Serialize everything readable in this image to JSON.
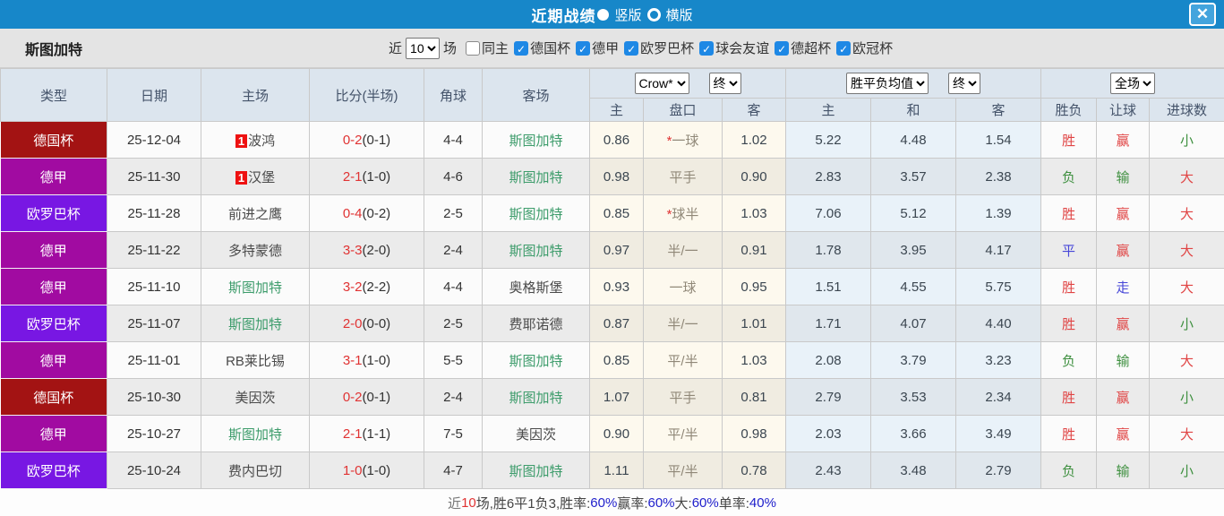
{
  "topbar": {
    "title": "近期战绩",
    "radio_vertical": "竖版",
    "radio_horizontal": "横版",
    "close": "✕"
  },
  "filter": {
    "team": "斯图加特",
    "recent_label": "近",
    "recent_value": "10",
    "matches_label": "场",
    "check_glyph": "✓",
    "checkboxes": [
      {
        "label": "同主",
        "checked": false
      },
      {
        "label": "德国杯",
        "checked": true
      },
      {
        "label": "德甲",
        "checked": true
      },
      {
        "label": "欧罗巴杯",
        "checked": true
      },
      {
        "label": "球会友谊",
        "checked": true
      },
      {
        "label": "德超杯",
        "checked": true
      },
      {
        "label": "欧冠杯",
        "checked": true
      }
    ]
  },
  "header": {
    "cols": [
      "类型",
      "日期",
      "主场",
      "比分(半场)",
      "角球",
      "客场"
    ],
    "selects": {
      "odds_source": "Crow*",
      "odds_time": "终",
      "avg_label": "胜平负均值",
      "avg_time": "终",
      "scope": "全场"
    },
    "sub": [
      "主",
      "盘口",
      "客",
      "主",
      "和",
      "客",
      "胜负",
      "让球",
      "进球数"
    ]
  },
  "colors": {
    "accent_blue": "#1787c9",
    "badge_cup": "#a31313",
    "badge_league": "#a10ba1",
    "badge_europa": "#7817e3",
    "win_red": "#e04444",
    "loss_green": "#3f9040",
    "draw_blue": "#4646d8",
    "stuttgart_green": "#3d9c6b"
  },
  "table": {
    "rows": [
      {
        "type": "德国杯",
        "type_key": "cup",
        "date": "25-12-04",
        "home": "波鸿",
        "home_badge": "1",
        "home_self": false,
        "score": "0-2",
        "half": "(0-1)",
        "corner": "4-4",
        "away": "斯图加特",
        "away_self": true,
        "o_home": "0.86",
        "hcap_star": true,
        "hcap": "一球",
        "o_away": "1.02",
        "a_home": "5.22",
        "a_draw": "4.48",
        "a_away": "1.54",
        "res": "胜",
        "res_c": "r",
        "hres": "赢",
        "hres_c": "r",
        "gres": "小",
        "gres_c": "g"
      },
      {
        "type": "德甲",
        "type_key": "league",
        "date": "25-11-30",
        "home": "汉堡",
        "home_badge": "1",
        "home_self": false,
        "score": "2-1",
        "half": "(1-0)",
        "corner": "4-6",
        "away": "斯图加特",
        "away_self": true,
        "o_home": "0.98",
        "hcap_star": false,
        "hcap": "平手",
        "o_away": "0.90",
        "a_home": "2.83",
        "a_draw": "3.57",
        "a_away": "2.38",
        "res": "负",
        "res_c": "g",
        "hres": "输",
        "hres_c": "g",
        "gres": "大",
        "gres_c": "r"
      },
      {
        "type": "欧罗巴杯",
        "type_key": "europa",
        "date": "25-11-28",
        "home": "前进之鹰",
        "home_badge": "",
        "home_self": false,
        "score": "0-4",
        "half": "(0-2)",
        "corner": "2-5",
        "away": "斯图加特",
        "away_self": true,
        "o_home": "0.85",
        "hcap_star": true,
        "hcap": "球半",
        "o_away": "1.03",
        "a_home": "7.06",
        "a_draw": "5.12",
        "a_away": "1.39",
        "res": "胜",
        "res_c": "r",
        "hres": "赢",
        "hres_c": "r",
        "gres": "大",
        "gres_c": "r"
      },
      {
        "type": "德甲",
        "type_key": "league",
        "date": "25-11-22",
        "home": "多特蒙德",
        "home_badge": "",
        "home_self": false,
        "score": "3-3",
        "half": "(2-0)",
        "corner": "2-4",
        "away": "斯图加特",
        "away_self": true,
        "o_home": "0.97",
        "hcap_star": false,
        "hcap": "半/一",
        "o_away": "0.91",
        "a_home": "1.78",
        "a_draw": "3.95",
        "a_away": "4.17",
        "res": "平",
        "res_c": "b",
        "hres": "赢",
        "hres_c": "r",
        "gres": "大",
        "gres_c": "r"
      },
      {
        "type": "德甲",
        "type_key": "league",
        "date": "25-11-10",
        "home": "斯图加特",
        "home_badge": "",
        "home_self": true,
        "score": "3-2",
        "half": "(2-2)",
        "corner": "4-4",
        "away": "奥格斯堡",
        "away_self": false,
        "o_home": "0.93",
        "hcap_star": false,
        "hcap": "一球",
        "o_away": "0.95",
        "a_home": "1.51",
        "a_draw": "4.55",
        "a_away": "5.75",
        "res": "胜",
        "res_c": "r",
        "hres": "走",
        "hres_c": "b",
        "gres": "大",
        "gres_c": "r"
      },
      {
        "type": "欧罗巴杯",
        "type_key": "europa",
        "date": "25-11-07",
        "home": "斯图加特",
        "home_badge": "",
        "home_self": true,
        "score": "2-0",
        "half": "(0-0)",
        "corner": "2-5",
        "away": "费耶诺德",
        "away_self": false,
        "o_home": "0.87",
        "hcap_star": false,
        "hcap": "半/一",
        "o_away": "1.01",
        "a_home": "1.71",
        "a_draw": "4.07",
        "a_away": "4.40",
        "res": "胜",
        "res_c": "r",
        "hres": "赢",
        "hres_c": "r",
        "gres": "小",
        "gres_c": "g"
      },
      {
        "type": "德甲",
        "type_key": "league",
        "date": "25-11-01",
        "home": "RB莱比锡",
        "home_badge": "",
        "home_self": false,
        "score": "3-1",
        "half": "(1-0)",
        "corner": "5-5",
        "away": "斯图加特",
        "away_self": true,
        "o_home": "0.85",
        "hcap_star": false,
        "hcap": "平/半",
        "o_away": "1.03",
        "a_home": "2.08",
        "a_draw": "3.79",
        "a_away": "3.23",
        "res": "负",
        "res_c": "g",
        "hres": "输",
        "hres_c": "g",
        "gres": "大",
        "gres_c": "r"
      },
      {
        "type": "德国杯",
        "type_key": "cup",
        "date": "25-10-30",
        "home": "美因茨",
        "home_badge": "",
        "home_self": false,
        "score": "0-2",
        "half": "(0-1)",
        "corner": "2-4",
        "away": "斯图加特",
        "away_self": true,
        "o_home": "1.07",
        "hcap_star": false,
        "hcap": "平手",
        "o_away": "0.81",
        "a_home": "2.79",
        "a_draw": "3.53",
        "a_away": "2.34",
        "res": "胜",
        "res_c": "r",
        "hres": "赢",
        "hres_c": "r",
        "gres": "小",
        "gres_c": "g"
      },
      {
        "type": "德甲",
        "type_key": "league",
        "date": "25-10-27",
        "home": "斯图加特",
        "home_badge": "",
        "home_self": true,
        "score": "2-1",
        "half": "(1-1)",
        "corner": "7-5",
        "away": "美因茨",
        "away_self": false,
        "o_home": "0.90",
        "hcap_star": false,
        "hcap": "平/半",
        "o_away": "0.98",
        "a_home": "2.03",
        "a_draw": "3.66",
        "a_away": "3.49",
        "res": "胜",
        "res_c": "r",
        "hres": "赢",
        "hres_c": "r",
        "gres": "大",
        "gres_c": "r"
      },
      {
        "type": "欧罗巴杯",
        "type_key": "europa",
        "date": "25-10-24",
        "home": "费内巴切",
        "home_badge": "",
        "home_self": false,
        "score": "1-0",
        "half": "(1-0)",
        "corner": "4-7",
        "away": "斯图加特",
        "away_self": true,
        "o_home": "1.11",
        "hcap_star": false,
        "hcap": "平/半",
        "o_away": "0.78",
        "a_home": "2.43",
        "a_draw": "3.48",
        "a_away": "2.79",
        "res": "负",
        "res_c": "g",
        "hres": "输",
        "hres_c": "g",
        "gres": "小",
        "gres_c": "g"
      }
    ]
  },
  "summary": {
    "segments": [
      {
        "t": "近",
        "c": "dim"
      },
      {
        "t": "10",
        "c": "red"
      },
      {
        "t": "场,胜6平1负3, ",
        "c": "dark"
      },
      {
        "t": "胜率:",
        "c": "dark"
      },
      {
        "t": "60%",
        "c": "blue"
      },
      {
        "t": " 赢率:",
        "c": "dark"
      },
      {
        "t": "60%",
        "c": "blue"
      },
      {
        "t": " 大:",
        "c": "dark"
      },
      {
        "t": "60%",
        "c": "blue"
      },
      {
        "t": " 单率:",
        "c": "dark"
      },
      {
        "t": "40%",
        "c": "blue"
      }
    ]
  }
}
